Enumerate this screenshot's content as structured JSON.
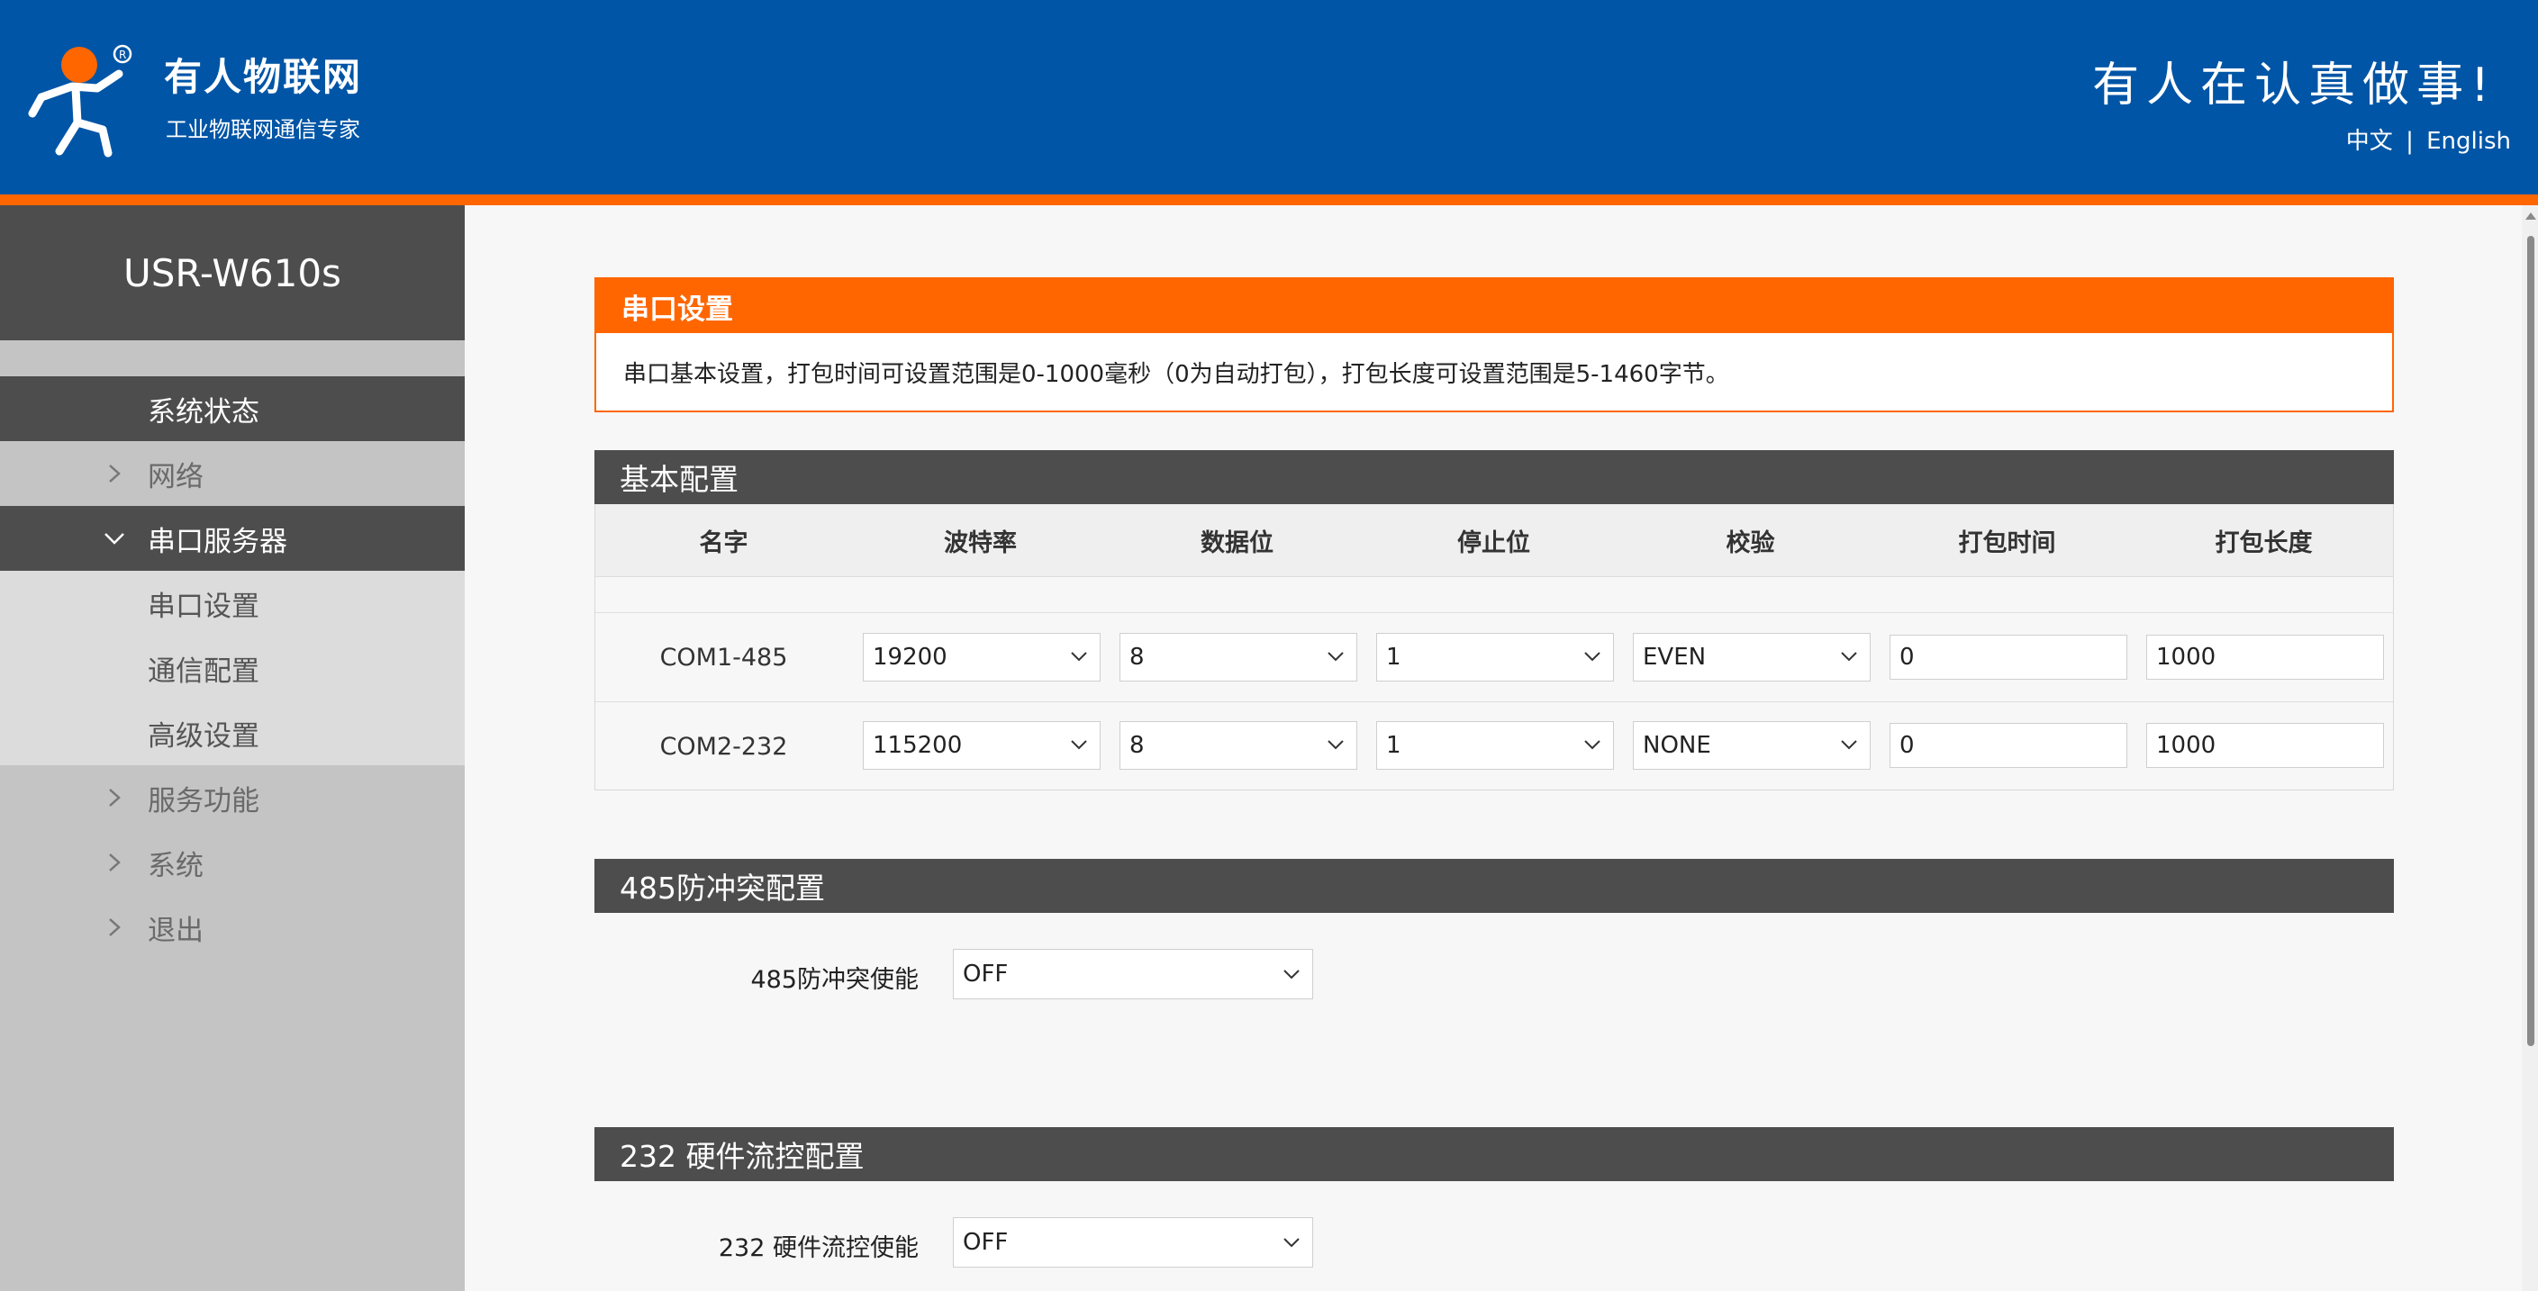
{
  "header": {
    "brand_name": "有人物联网",
    "brand_slogan": "工业物联网通信专家",
    "motto": "有人在认真做事!",
    "lang_cn": "中文",
    "lang_separator": "|",
    "lang_en": "English"
  },
  "sidebar": {
    "device_title": "USR-W610s",
    "items": [
      {
        "label": "系统状态"
      },
      {
        "label": "网络"
      },
      {
        "label": "串口服务器"
      },
      {
        "label": "串口设置"
      },
      {
        "label": "通信配置"
      },
      {
        "label": "高级设置"
      },
      {
        "label": "服务功能"
      },
      {
        "label": "系统"
      },
      {
        "label": "退出"
      }
    ]
  },
  "info": {
    "title": "串口设置",
    "text": "串口基本设置，打包时间可设置范围是0-1000毫秒（0为自动打包），打包长度可设置范围是5-1460字节。"
  },
  "basic": {
    "title": "基本配置",
    "headers": [
      "名字",
      "波特率",
      "数据位",
      "停止位",
      "校验",
      "打包时间",
      "打包长度"
    ],
    "rows": [
      {
        "name": "COM1-485",
        "baud": "19200",
        "data_bits": "8",
        "stop_bits": "1",
        "parity": "EVEN",
        "pack_time": "0",
        "pack_len": "1000"
      },
      {
        "name": "COM2-232",
        "baud": "115200",
        "data_bits": "8",
        "stop_bits": "1",
        "parity": "NONE",
        "pack_time": "0",
        "pack_len": "1000"
      }
    ]
  },
  "anti_conflict": {
    "title": "485防冲突配置",
    "label": "485防冲突使能",
    "value": "OFF"
  },
  "flow_control": {
    "title": "232 硬件流控配置",
    "label": "232 硬件流控使能",
    "value": "OFF"
  },
  "colors": {
    "header_blue": "#0055a6",
    "accent_orange": "#ff6600",
    "dark_gray": "#4d4d4d",
    "sidebar_gray": "#c4c4c4"
  }
}
